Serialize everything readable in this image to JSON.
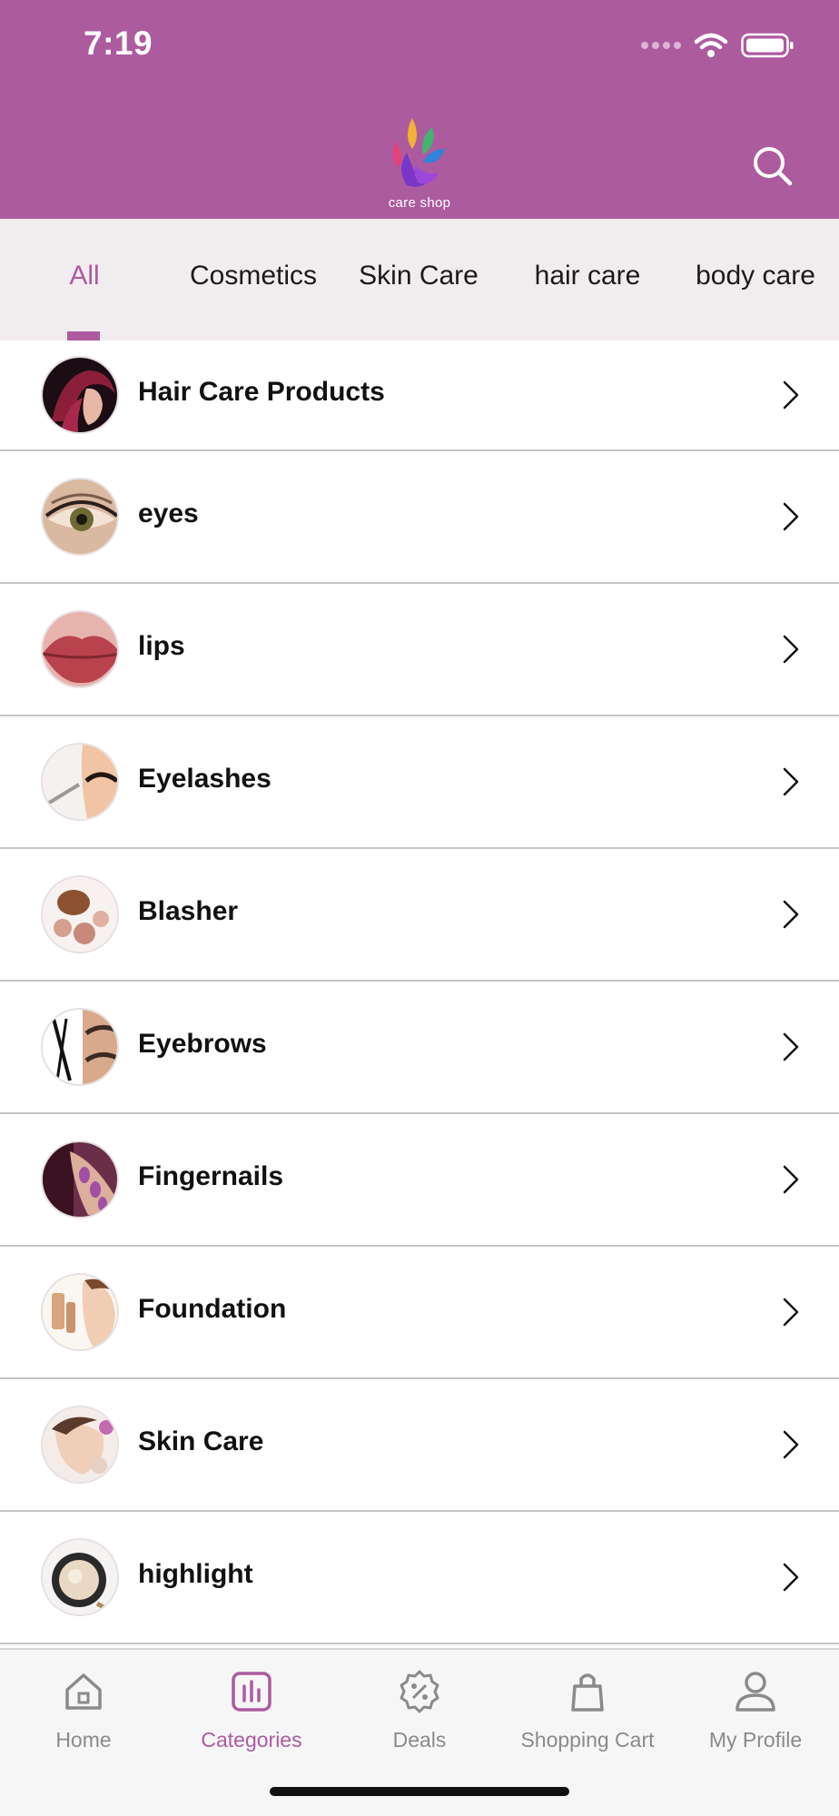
{
  "status_bar": {
    "time": "7:19",
    "icons": [
      "signal-dots-icon",
      "wifi-icon",
      "battery-icon"
    ]
  },
  "header": {
    "logo_text": "care shop",
    "search_icon": "search-icon",
    "background_color": "#ad5b9f"
  },
  "tabs": [
    {
      "label": "All",
      "active": true
    },
    {
      "label": "Cosmetics",
      "active": false
    },
    {
      "label": "Skin Care",
      "active": false
    },
    {
      "label": "hair care",
      "active": false
    },
    {
      "label": "body care",
      "active": false
    }
  ],
  "categories": [
    {
      "label": "Hair Care Products",
      "image": "hair-model-photo"
    },
    {
      "label": "eyes",
      "image": "eye-photo"
    },
    {
      "label": "lips",
      "image": "lips-photo"
    },
    {
      "label": "Eyelashes",
      "image": "eyelashes-photo"
    },
    {
      "label": "Blasher",
      "image": "blush-photo"
    },
    {
      "label": "Eyebrows",
      "image": "eyebrows-photo"
    },
    {
      "label": "Fingernails",
      "image": "fingernails-photo"
    },
    {
      "label": "Foundation",
      "image": "foundation-photo"
    },
    {
      "label": "Skin Care",
      "image": "skin-care-photo"
    },
    {
      "label": "highlight",
      "image": "highlight-photo"
    }
  ],
  "tabbar": [
    {
      "label": "Home",
      "icon": "home-icon",
      "active": false
    },
    {
      "label": "Categories",
      "icon": "categories-icon",
      "active": true
    },
    {
      "label": "Deals",
      "icon": "deals-icon",
      "active": false
    },
    {
      "label": "Shopping Cart",
      "icon": "shopping-cart-icon",
      "active": false
    },
    {
      "label": "My Profile",
      "icon": "profile-icon",
      "active": false
    }
  ],
  "colors": {
    "accent": "#ad5b9f",
    "tabs_background": "#f1edee",
    "inactive_gray": "#8a8a8a"
  }
}
